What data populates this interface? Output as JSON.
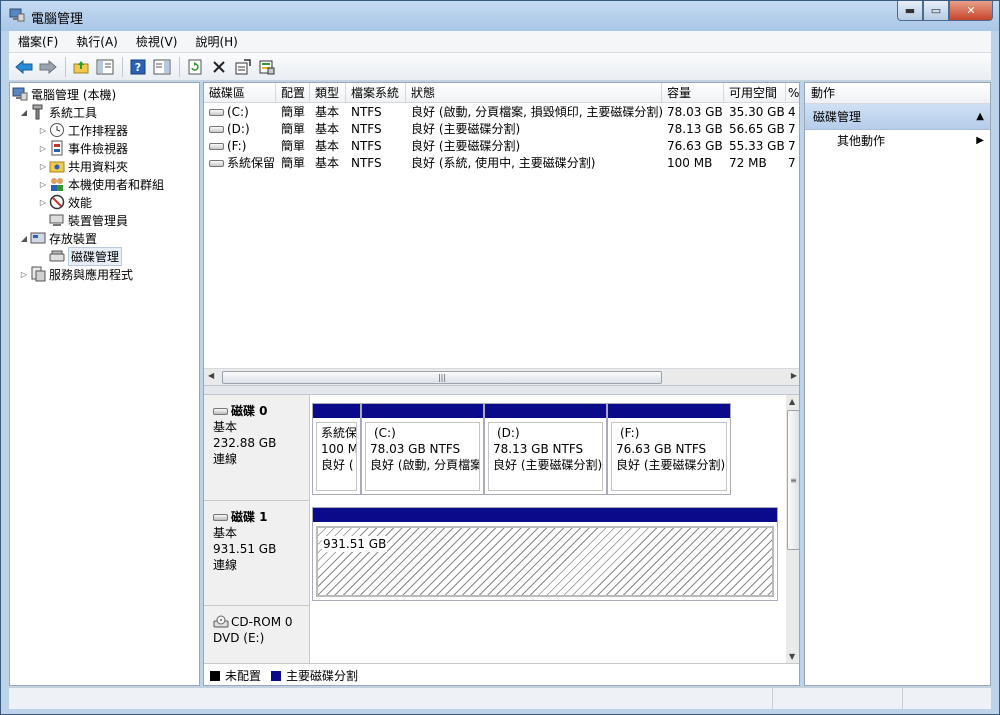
{
  "window": {
    "title": "電腦管理"
  },
  "menu": [
    "檔案(F)",
    "執行(A)",
    "檢視(V)",
    "說明(H)"
  ],
  "toolbar": {
    "icons": [
      "back-arrow-icon",
      "forward-arrow-icon",
      "folder-up-icon",
      "show-hide-tree-icon",
      "help-icon",
      "show-hide-action-icon",
      "refresh-icon",
      "delete-icon",
      "properties-icon",
      "export-icon"
    ]
  },
  "tree": [
    {
      "label": "電腦管理 (本機)",
      "icon": "computer-icon"
    },
    {
      "label": "系統工具",
      "icon": "tools-icon"
    },
    {
      "label": "工作排程器",
      "icon": "clock-icon"
    },
    {
      "label": "事件檢視器",
      "icon": "event-viewer-icon"
    },
    {
      "label": "共用資料夾",
      "icon": "shared-folder-icon"
    },
    {
      "label": "本機使用者和群組",
      "icon": "users-icon"
    },
    {
      "label": "效能",
      "icon": "performance-icon"
    },
    {
      "label": "裝置管理員",
      "icon": "device-manager-icon"
    },
    {
      "label": "存放裝置",
      "icon": "storage-icon"
    },
    {
      "label": "磁碟管理",
      "icon": "disk-management-icon"
    },
    {
      "label": "服務與應用程式",
      "icon": "services-icon"
    }
  ],
  "volume_list": {
    "headers": [
      "磁碟區",
      "配置",
      "類型",
      "檔案系統",
      "狀態",
      "容量",
      "可用空間",
      "%"
    ],
    "rows": [
      [
        "(C:)",
        "簡單",
        "基本",
        "NTFS",
        "良好 (啟動, 分頁檔案, 損毀傾印, 主要磁碟分割)",
        "78.03 GB",
        "35.30 GB",
        "4"
      ],
      [
        "(D:)",
        "簡單",
        "基本",
        "NTFS",
        "良好 (主要磁碟分割)",
        "78.13 GB",
        "56.65 GB",
        "7"
      ],
      [
        "(F:)",
        "簡單",
        "基本",
        "NTFS",
        "良好 (主要磁碟分割)",
        "76.63 GB",
        "55.33 GB",
        "7"
      ],
      [
        "系統保留",
        "簡單",
        "基本",
        "NTFS",
        "良好 (系統, 使用中, 主要磁碟分割)",
        "100 MB",
        "72 MB",
        "7"
      ]
    ]
  },
  "disks": [
    {
      "name": "磁碟 0",
      "type": "基本",
      "size": "232.88 GB",
      "state": "連線",
      "partitions": [
        {
          "name": "系統保",
          "size": "100 M",
          "status": "良好 ("
        },
        {
          "name": "(C:)",
          "size": "78.03 GB NTFS",
          "status": "良好 (啟動, 分頁檔案"
        },
        {
          "name": "(D:)",
          "size": "78.13 GB NTFS",
          "status": "良好 (主要磁碟分割)"
        },
        {
          "name": "(F:)",
          "size": "76.63 GB NTFS",
          "status": "良好 (主要磁碟分割)"
        }
      ]
    },
    {
      "name": "磁碟 1",
      "type": "基本",
      "size": "931.51 GB",
      "state": "連線",
      "partitions": [
        {
          "size": "931.51 GB"
        }
      ]
    },
    {
      "name": "CD-ROM 0",
      "type": "DVD (E:)"
    }
  ],
  "legend": [
    {
      "label": "未配置",
      "color": "#000000"
    },
    {
      "label": "主要磁碟分割",
      "color": "#0a0a8a"
    }
  ],
  "actions": {
    "header": "動作",
    "section": "磁碟管理",
    "items": [
      "其他動作"
    ]
  }
}
